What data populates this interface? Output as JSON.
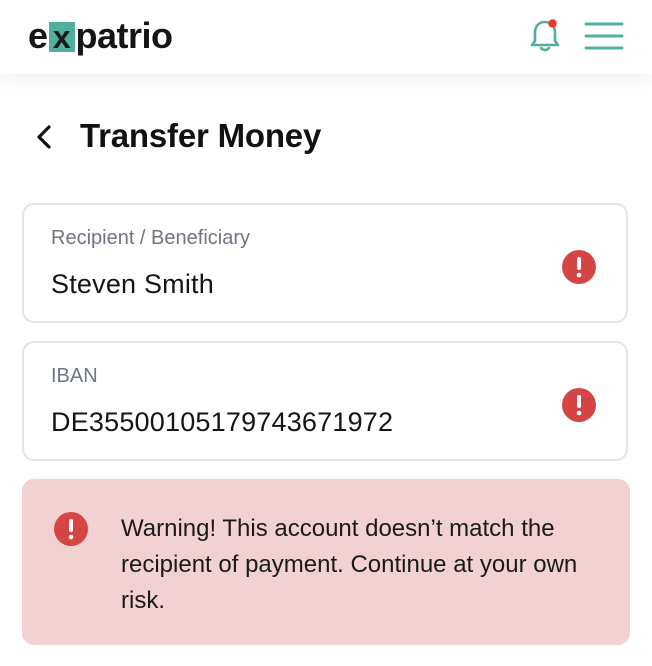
{
  "app": {
    "logo_prefix": "e",
    "logo_x": "x",
    "logo_suffix": "patrio",
    "brand_color": "#4fb0a0",
    "notification_dot_color": "#e5372b"
  },
  "header": {
    "bell_icon": "bell-icon",
    "menu_icon": "hamburger-menu-icon"
  },
  "page": {
    "back_icon": "chevron-left-icon",
    "title": "Transfer Money"
  },
  "form": {
    "recipient": {
      "label": "Recipient / Beneficiary",
      "value": "Steven Smith",
      "status_icon": "error-icon"
    },
    "iban": {
      "label": "IBAN",
      "value": "DE35500105179743671972",
      "status_icon": "error-icon"
    }
  },
  "warning": {
    "icon": "error-icon",
    "text": "Warning! This account doesn’t match the recipient of payment. Continue at your own risk.",
    "background": "#f2d1d2",
    "icon_color": "#d64545"
  }
}
